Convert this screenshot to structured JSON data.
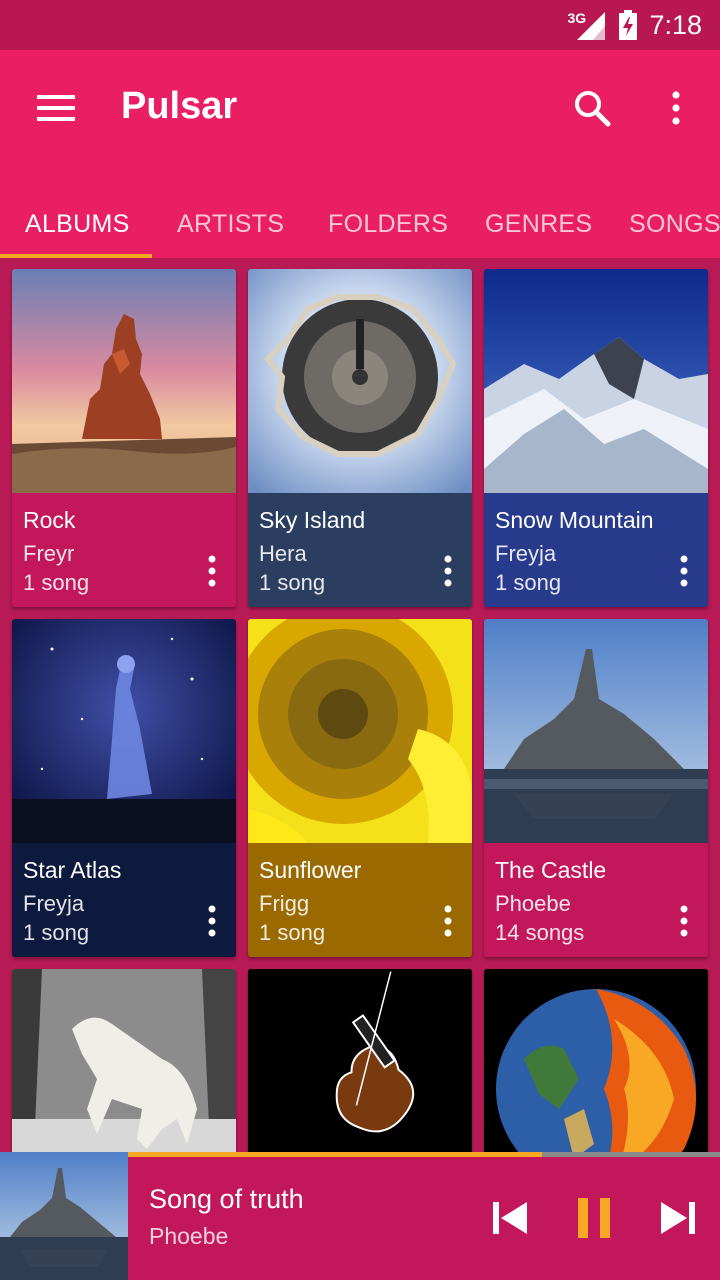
{
  "status_bar": {
    "network": "3G",
    "time": "7:18"
  },
  "app_bar": {
    "title": "Pulsar",
    "menu_icon": "hamburger-menu-icon",
    "search_icon": "search-icon",
    "more_icon": "more-vert-icon"
  },
  "tabs": [
    {
      "label": "ALBUMS",
      "active": true
    },
    {
      "label": "ARTISTS",
      "active": false
    },
    {
      "label": "FOLDERS",
      "active": false
    },
    {
      "label": "GENRES",
      "active": false
    },
    {
      "label": "SONGS",
      "active": false
    }
  ],
  "albums": [
    {
      "title": "Rock",
      "artist": "Freyr",
      "count": "1 song",
      "color": "#c2185b",
      "art": "desert-rock-formation"
    },
    {
      "title": "Sky Island",
      "artist": "Hera",
      "count": "1 song",
      "color": "#2c3e5f",
      "art": "tiny-planet-town"
    },
    {
      "title": "Snow Mountain",
      "artist": "Freyja",
      "count": "1 song",
      "color": "#283a8c",
      "art": "snowy-mountain-peak"
    },
    {
      "title": "Star Atlas",
      "artist": "Freyja",
      "count": "1 song",
      "color": "#0d1a3e",
      "art": "glowing-figure-night"
    },
    {
      "title": "Sunflower",
      "artist": "Frigg",
      "count": "1 song",
      "color": "#9a6a00",
      "art": "sunflower-closeup"
    },
    {
      "title": "The Castle",
      "artist": "Phoebe",
      "count": "14 songs",
      "color": "#c2185b",
      "art": "island-castle"
    },
    {
      "title": "",
      "artist": "",
      "count": "",
      "color": "#9e9e9e",
      "art": "white-horse-forest"
    },
    {
      "title": "",
      "artist": "",
      "count": "",
      "color": "#111111",
      "art": "neon-violin"
    },
    {
      "title": "",
      "artist": "",
      "count": "",
      "color": "#1a1a1a",
      "art": "earth-on-fire"
    }
  ],
  "now_playing": {
    "title": "Song of truth",
    "artist": "Phoebe",
    "progress": 0.7,
    "art": "island-castle",
    "prev_icon": "skip-previous-icon",
    "pause_icon": "pause-icon",
    "next_icon": "skip-next-icon"
  },
  "colors": {
    "primary": "#e91e63",
    "primary_dark": "#b8174f",
    "accent": "#f9a825"
  }
}
